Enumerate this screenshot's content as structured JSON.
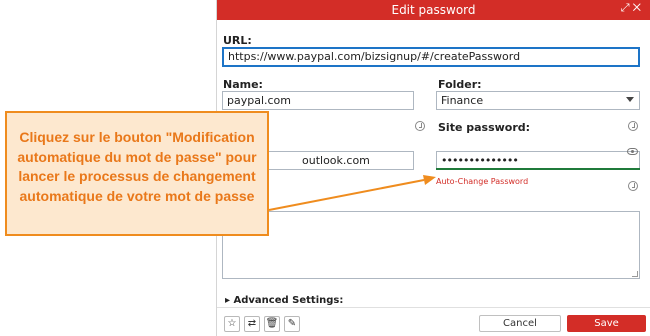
{
  "dialog": {
    "title": "Edit password",
    "url_label": "URL:",
    "url_value": "https://www.paypal.com/bizsignup/#/createPassword",
    "name_label": "Name:",
    "name_value": "paypal.com",
    "folder_label": "Folder:",
    "folder_value": "Finance",
    "username_value": "outlook.com",
    "site_password_label": "Site password:",
    "site_password_value": "••••••••••••••",
    "auto_change_link": "Auto-Change Password",
    "advanced_settings": "Advanced Settings:",
    "cancel_label": "Cancel",
    "save_label": "Save",
    "accent_color": "#d32d27",
    "focus_color": "#1d74c7",
    "strength_color": "#1f7a3a"
  },
  "footer_icons": [
    "star-icon",
    "share-icon",
    "trash-icon",
    "pin-icon"
  ],
  "callout": {
    "text": "Cliquez sur le bouton \"Modification automatique du mot de passe\" pour lancer le processus de changement automatique de votre mot de passe",
    "color": "#e9781a",
    "background": "#fde8cf"
  }
}
